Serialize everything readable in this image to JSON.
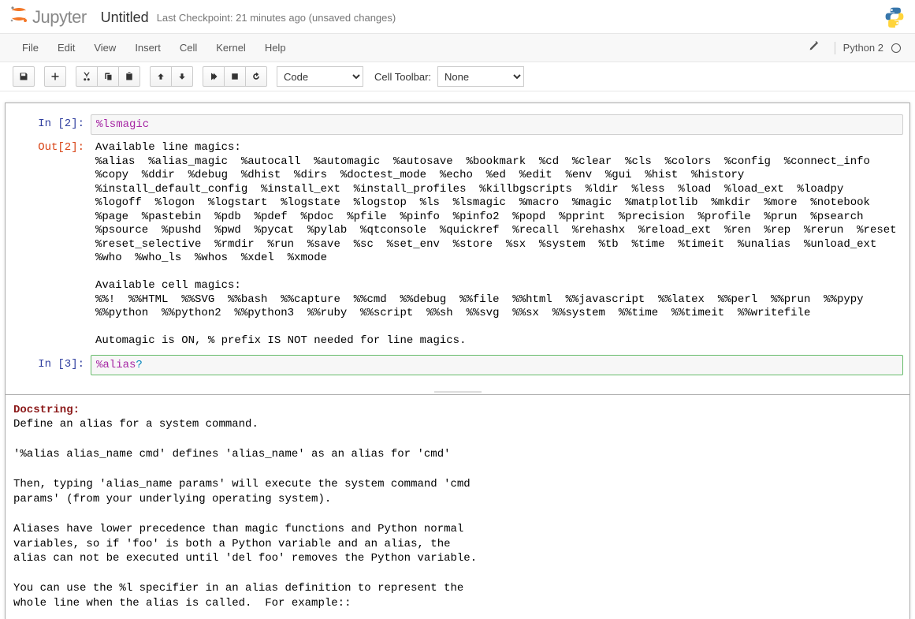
{
  "header": {
    "logo_text": "Jupyter",
    "title": "Untitled",
    "checkpoint": "Last Checkpoint: 21 minutes ago",
    "unsaved": "(unsaved changes)"
  },
  "menu": {
    "file": "File",
    "edit": "Edit",
    "view": "View",
    "insert": "Insert",
    "cell": "Cell",
    "kernel": "Kernel",
    "help": "Help"
  },
  "kernel": {
    "name": "Python 2"
  },
  "toolbar": {
    "cell_type": "Code",
    "ct_label": "Cell Toolbar:",
    "ct_value": "None"
  },
  "cells": {
    "cell1": {
      "in_label": "In [2]:",
      "code": "%lsmagic",
      "out_label": "Out[2]:",
      "output": "Available line magics:\n%alias  %alias_magic  %autocall  %automagic  %autosave  %bookmark  %cd  %clear  %cls  %colors  %config  %connect_info  %copy  %ddir  %debug  %dhist  %dirs  %doctest_mode  %echo  %ed  %edit  %env  %gui  %hist  %history  %install_default_config  %install_ext  %install_profiles  %killbgscripts  %ldir  %less  %load  %load_ext  %loadpy  %logoff  %logon  %logstart  %logstate  %logstop  %ls  %lsmagic  %macro  %magic  %matplotlib  %mkdir  %more  %notebook  %page  %pastebin  %pdb  %pdef  %pdoc  %pfile  %pinfo  %pinfo2  %popd  %pprint  %precision  %profile  %prun  %psearch  %psource  %pushd  %pwd  %pycat  %pylab  %qtconsole  %quickref  %recall  %rehashx  %reload_ext  %ren  %rep  %rerun  %reset  %reset_selective  %rmdir  %run  %save  %sc  %set_env  %store  %sx  %system  %tb  %time  %timeit  %unalias  %unload_ext  %who  %who_ls  %whos  %xdel  %xmode\n\nAvailable cell magics:\n%%!  %%HTML  %%SVG  %%bash  %%capture  %%cmd  %%debug  %%file  %%html  %%javascript  %%latex  %%perl  %%prun  %%pypy  %%python  %%python2  %%python3  %%ruby  %%script  %%sh  %%svg  %%sx  %%system  %%time  %%timeit  %%writefile\n\nAutomagic is ON, % prefix IS NOT needed for line magics."
    },
    "cell2": {
      "in_label": "In [3]:",
      "code_magic": "%alias",
      "code_q": "?"
    }
  },
  "pager": {
    "title": "Docstring:",
    "body": "Define an alias for a system command.\n\n'%alias alias_name cmd' defines 'alias_name' as an alias for 'cmd'\n\nThen, typing 'alias_name params' will execute the system command 'cmd\nparams' (from your underlying operating system).\n\nAliases have lower precedence than magic functions and Python normal\nvariables, so if 'foo' is both a Python variable and an alias, the\nalias can not be executed until 'del foo' removes the Python variable.\n\nYou can use the %l specifier in an alias definition to represent the\nwhole line when the alias is called.  For example::"
  }
}
